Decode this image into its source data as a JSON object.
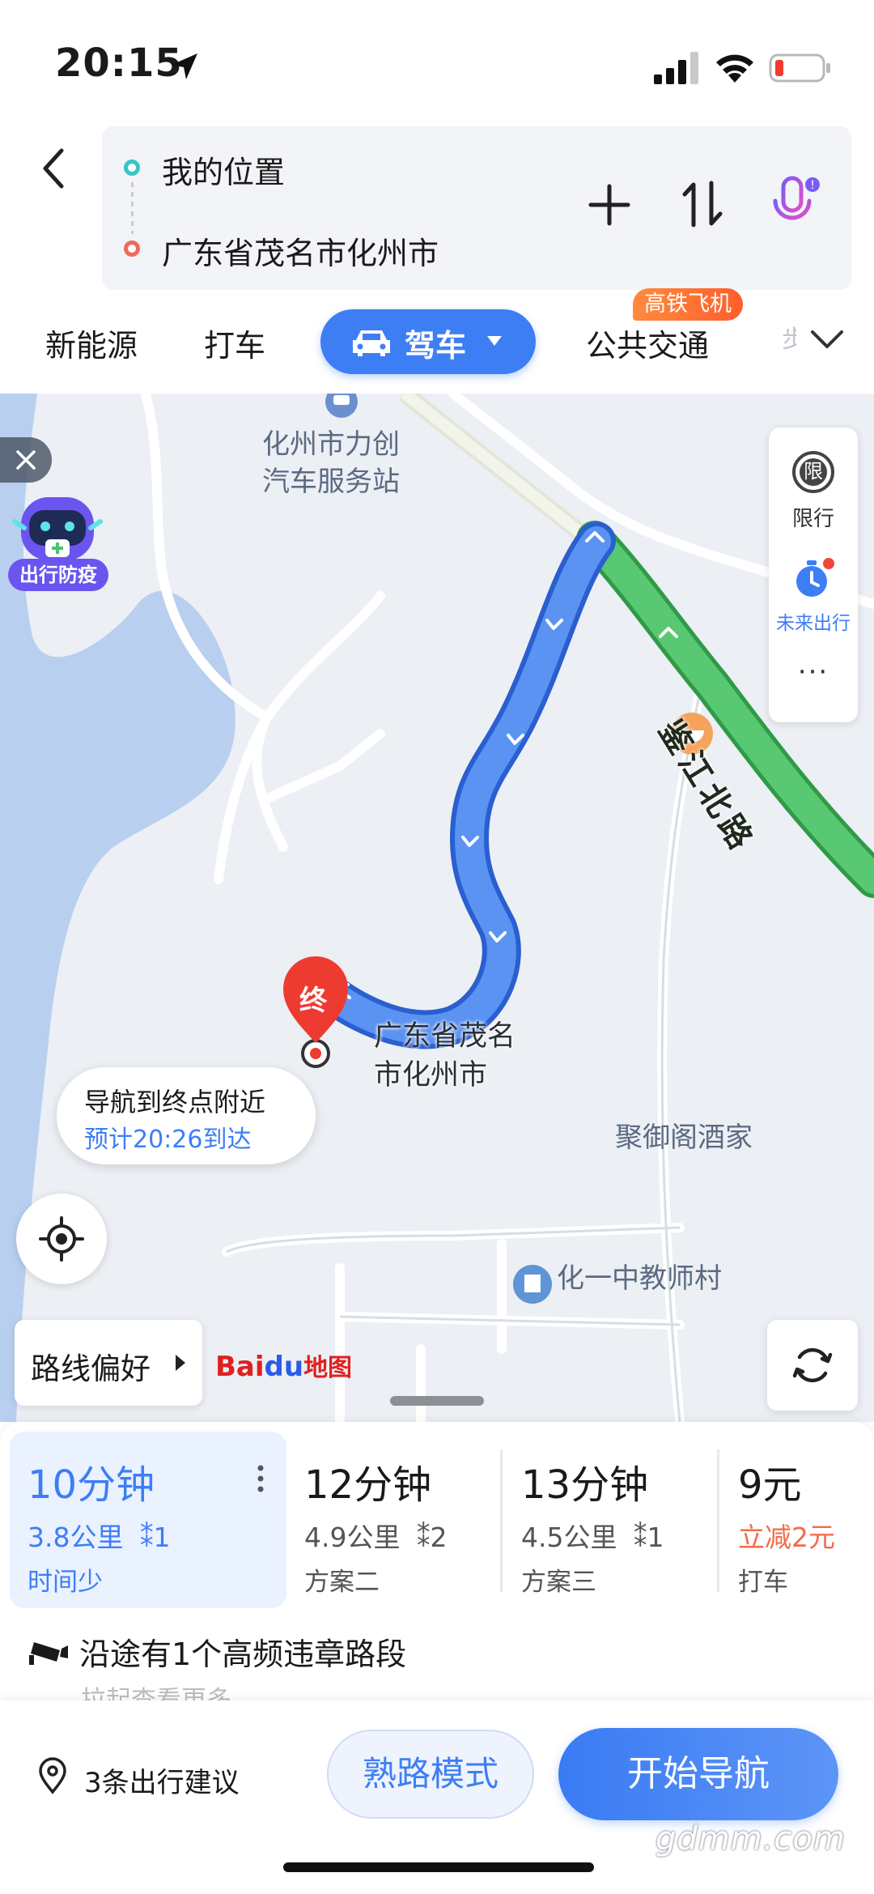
{
  "status_bar": {
    "time": "20:15"
  },
  "route_input": {
    "start": "我的位置",
    "end": "广东省茂名市化州市"
  },
  "tabs": {
    "new_energy": "新能源",
    "taxi": "打车",
    "drive": "驾车",
    "transit": "公共交通",
    "transit_badge": "高铁飞机",
    "more_partial": "步"
  },
  "map": {
    "poi_lichuang": [
      "化州市力创",
      "汽车服务站"
    ],
    "road_name": "鉴江北路",
    "destination_marker": "终",
    "destination_name": [
      "广东省茂名",
      "市化州市"
    ],
    "poi_restaurant": "聚御阁酒家",
    "poi_teacher_village": "化一中教师村",
    "epidemic_label": "出行防疫",
    "side_panel": {
      "limit_glyph": "限",
      "limit_label": "限行",
      "future_label": "未来出行",
      "more": "···"
    },
    "nav_bubble": {
      "title": "导航到终点附近",
      "eta": "预计20:26到达"
    },
    "route_preference": "路线偏好",
    "logo": {
      "bai": "Bai",
      "du": "du",
      "ditu": "地图"
    }
  },
  "routes": [
    {
      "time": "10分钟",
      "distance": "3.8公里",
      "lights": "1",
      "tag": "时间少",
      "selected": true
    },
    {
      "time": "12分钟",
      "distance": "4.9公里",
      "lights": "2",
      "tag": "方案二",
      "selected": false
    },
    {
      "time": "13分钟",
      "distance": "4.5公里",
      "lights": "1",
      "tag": "方案三",
      "selected": false
    },
    {
      "time": "9元",
      "discount": "立减2元",
      "tag": "打车",
      "selected": false
    }
  ],
  "notice": {
    "warning": "沿途有1个高频违章路段",
    "pull_hint": "拉起查看更多"
  },
  "bottom": {
    "suggestions": "3条出行建议",
    "familiar_mode": "熟路模式",
    "start_nav": "开始导航"
  },
  "watermark": "gdmm.com",
  "colors": {
    "accent": "#3d7ef5",
    "route_green": "#4fbf6a",
    "destination_red": "#ee3b32",
    "discount": "#f26b4b"
  }
}
